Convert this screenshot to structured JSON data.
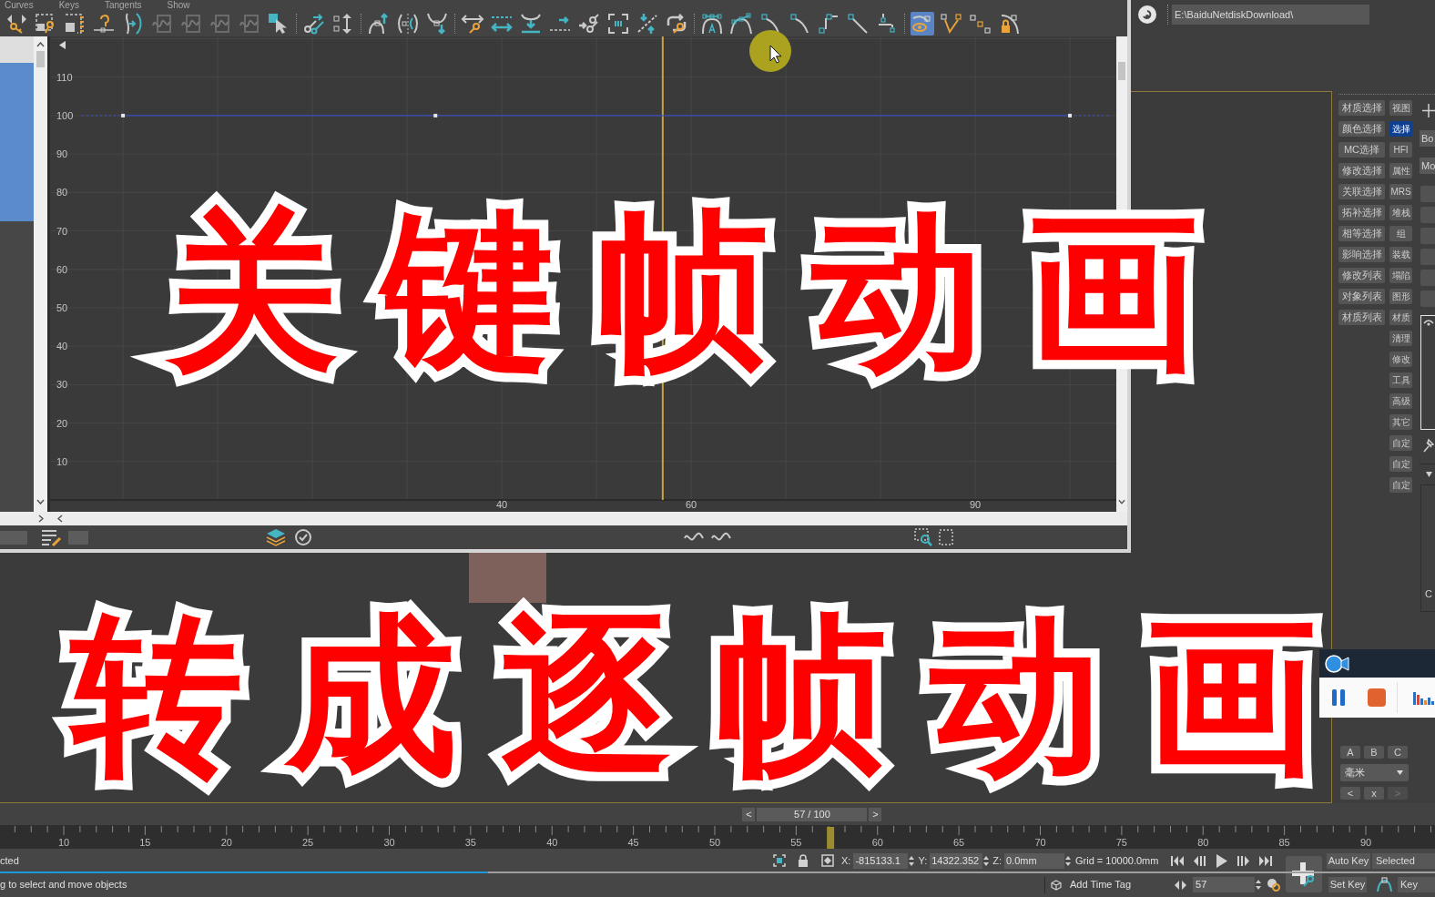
{
  "curve_editor": {
    "menu": [
      "Curves",
      "Keys",
      "Tangents",
      "Show"
    ],
    "toolbar": {
      "groups": [
        {
          "buttons": [
            {
              "selected": false,
              "disabled": false
            },
            {
              "selected": false,
              "disabled": false
            },
            {
              "selected": false,
              "disabled": false
            },
            {
              "selected": false,
              "disabled": false
            },
            {
              "selected": false,
              "disabled": false
            },
            {
              "selected": false,
              "disabled": true
            },
            {
              "selected": false,
              "disabled": true
            },
            {
              "selected": false,
              "disabled": true
            },
            {
              "selected": false,
              "disabled": true
            },
            {
              "selected": false,
              "disabled": false
            }
          ]
        },
        {
          "buttons": [
            {
              "selected": false,
              "disabled": false
            },
            {
              "selected": false,
              "disabled": false
            }
          ]
        },
        {
          "buttons": [
            {
              "selected": false,
              "disabled": false
            },
            {
              "selected": false,
              "disabled": false
            },
            {
              "selected": false,
              "disabled": false
            }
          ]
        },
        {
          "buttons": [
            {
              "selected": false,
              "disabled": false
            },
            {
              "selected": false,
              "disabled": false
            },
            {
              "selected": false,
              "disabled": false
            },
            {
              "selected": false,
              "disabled": false
            },
            {
              "selected": false,
              "disabled": false
            },
            {
              "selected": false,
              "disabled": false
            },
            {
              "selected": false,
              "disabled": false
            },
            {
              "selected": false,
              "disabled": false
            }
          ]
        },
        {
          "buttons": [
            {
              "selected": false,
              "disabled": false
            },
            {
              "selected": false,
              "disabled": false
            },
            {
              "selected": false,
              "disabled": false
            },
            {
              "selected": false,
              "disabled": false
            },
            {
              "selected": false,
              "disabled": false
            },
            {
              "selected": false,
              "disabled": false
            },
            {
              "selected": false,
              "disabled": false
            }
          ]
        },
        {
          "buttons": [
            {
              "selected": true,
              "disabled": false
            },
            {
              "selected": false,
              "disabled": false
            },
            {
              "selected": false,
              "disabled": false
            },
            {
              "selected": false,
              "disabled": false
            }
          ]
        }
      ]
    },
    "track_list": {
      "rows": [
        {
          "selected": false
        },
        {
          "selected": true
        },
        {
          "selected": true
        },
        {
          "selected": true
        },
        {
          "selected": true
        },
        {
          "selected": true
        },
        {
          "selected": true
        }
      ]
    },
    "graph": {
      "chart_data": {
        "type": "line",
        "x": [
          0,
          33,
          100
        ],
        "series": [
          {
            "color": "#3b4cc0",
            "marker": "square",
            "values": [
              100,
              100,
              100
            ]
          }
        ],
        "xlim": [
          -7.7,
          104.9
        ],
        "ylim": [
          0,
          120.6
        ],
        "grid": true,
        "xticks": [
          {
            "value": 40,
            "label": "40"
          },
          {
            "value": 60,
            "label": "60"
          },
          {
            "value": 90,
            "label": "90"
          }
        ],
        "yticks": [
          {
            "value": 10,
            "label": "10"
          },
          {
            "value": 20,
            "label": "20"
          },
          {
            "value": 30,
            "label": "30"
          },
          {
            "value": 40,
            "label": "40"
          },
          {
            "value": 50,
            "label": "50"
          },
          {
            "value": 60,
            "label": "60"
          },
          {
            "value": 70,
            "label": "70"
          },
          {
            "value": 80,
            "label": "80"
          },
          {
            "value": 90,
            "label": "90"
          },
          {
            "value": 100,
            "label": "100"
          },
          {
            "value": 110,
            "label": "110"
          }
        ],
        "ref_lines": [
          {
            "axis": "x",
            "value": 57,
            "color": "#c9a43e"
          }
        ]
      }
    }
  },
  "address_bar": {
    "path": "E:\\BaiduNetdiskDownload\\"
  },
  "command_panel": {
    "left_buttons": [
      {
        "label": "材质选择",
        "selected": false
      },
      {
        "label": "颜色选择",
        "selected": false
      },
      {
        "label": "MC选择",
        "selected": false
      },
      {
        "label": "修改选择",
        "selected": false
      },
      {
        "label": "关联选择",
        "selected": false
      },
      {
        "label": "拓补选择",
        "selected": false
      },
      {
        "label": "相等选择",
        "selected": false
      },
      {
        "label": "影响选择",
        "selected": false
      },
      {
        "label": "修改列表",
        "selected": false
      },
      {
        "label": "对象列表",
        "selected": false
      },
      {
        "label": "材质列表",
        "selected": false
      }
    ],
    "right_buttons": [
      {
        "label": "视图",
        "selected": false
      },
      {
        "label": "选择",
        "selected": true
      },
      {
        "label": "HFI",
        "selected": false
      },
      {
        "label": "属性",
        "selected": false
      },
      {
        "label": "MRS",
        "selected": false
      },
      {
        "label": "堆栈",
        "selected": false
      },
      {
        "label": "组",
        "selected": false
      },
      {
        "label": "装载",
        "selected": false
      },
      {
        "label": "塌陷",
        "selected": false
      },
      {
        "label": "图形",
        "selected": false
      },
      {
        "label": "材质",
        "selected": false
      },
      {
        "label": "清理",
        "selected": false
      },
      {
        "label": "修改",
        "selected": false
      },
      {
        "label": "工具",
        "selected": false
      },
      {
        "label": "高级",
        "selected": false
      },
      {
        "label": "其它",
        "selected": false
      },
      {
        "label": "自定",
        "selected": false
      },
      {
        "label": "自定",
        "selected": false
      },
      {
        "label": "自定",
        "selected": false
      }
    ],
    "axis_buttons": [
      {
        "label": "A"
      },
      {
        "label": "B"
      },
      {
        "label": "C"
      }
    ],
    "unit_dropdown": {
      "value": "毫米"
    },
    "nav_buttons": [
      {
        "label": "<",
        "disabled": false
      },
      {
        "label": "x",
        "disabled": false
      },
      {
        "label": ">",
        "disabled": true
      }
    ]
  },
  "side_panel": {
    "fields": [
      "Bo",
      "Mo"
    ],
    "box_text": "C"
  },
  "time_slider": {
    "prev": "<",
    "label": "57 / 100",
    "next": ">",
    "level": 0.57
  },
  "timeline": {
    "labels": [
      "10",
      "15",
      "20",
      "25",
      "30",
      "35",
      "40",
      "45",
      "50",
      "55",
      "60",
      "65",
      "70",
      "75",
      "80",
      "85",
      "90"
    ]
  },
  "progress": {
    "level": 0.34
  },
  "status_bar": {
    "prompts": [
      "cted",
      "g to select and move objects"
    ],
    "coords": [
      {
        "label": "X:",
        "value": "-815133.1"
      },
      {
        "label": "Y:",
        "value": "14322.352"
      },
      {
        "label": "Z:",
        "value": "0.0mm"
      }
    ],
    "grid": "Grid = 10000.0mm",
    "time_tag": "Add Time Tag",
    "frame": "57",
    "auto_key": "Auto Key",
    "key_mode": "Selected",
    "set_key": "Set Key",
    "key_filters": "Key"
  },
  "title_overlay": [
    "关键帧动画",
    "转成逐帧动画"
  ]
}
